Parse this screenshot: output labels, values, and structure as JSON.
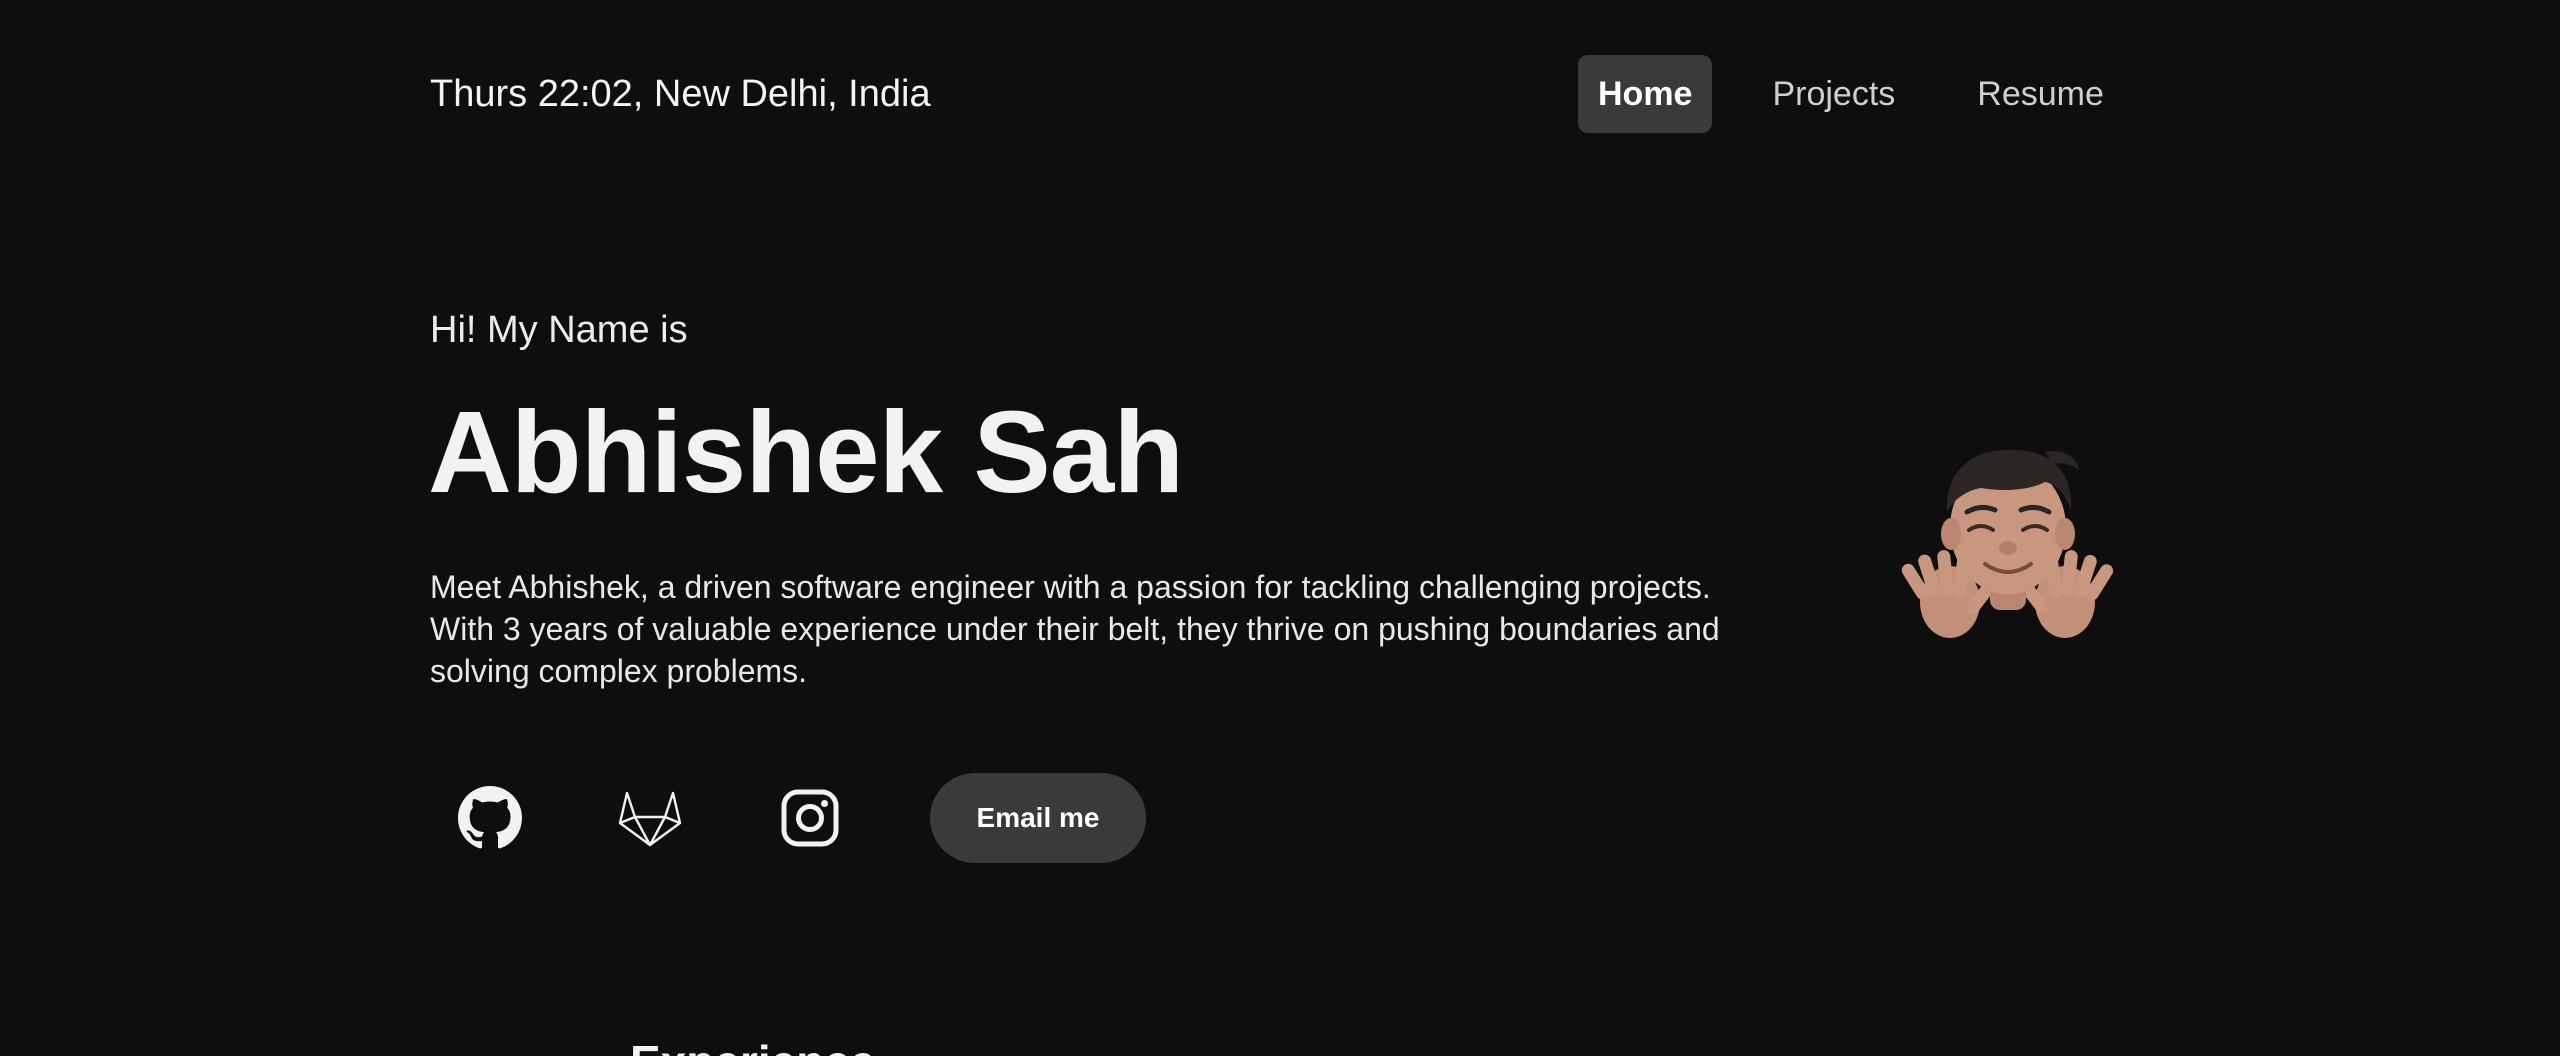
{
  "header": {
    "clock_text": "Thurs 22:02, New Delhi, India",
    "nav": {
      "home": "Home",
      "projects": "Projects",
      "resume": "Resume"
    }
  },
  "hero": {
    "greeting": "Hi! My Name is",
    "name": "Abhishek Sah",
    "bio": "Meet Abhishek, a driven software engineer with a passion for tackling challenging projects. With 3 years of valuable experience under their belt, they thrive on pushing boundaries and solving complex problems.",
    "avatar_icon": "memoji-waving-hands",
    "socials": [
      {
        "icon": "github-icon"
      },
      {
        "icon": "gitlab-icon"
      },
      {
        "icon": "instagram-icon"
      }
    ],
    "email_label": "Email me"
  },
  "sections": {
    "experience_title": "Experience"
  },
  "colors": {
    "background": "#0e0e0e",
    "text": "#f2f2f2",
    "muted_text": "#cfcfcf",
    "pill": "#3a3a3a"
  }
}
